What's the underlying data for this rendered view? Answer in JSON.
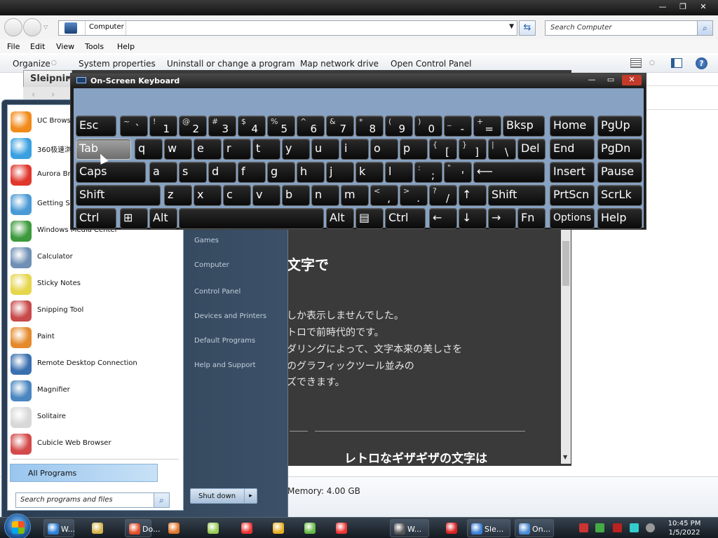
{
  "explorer": {
    "address": "Computer",
    "search_placeholder": "Search Computer",
    "menu": [
      "File",
      "Edit",
      "View",
      "Tools",
      "Help"
    ],
    "commands": [
      "Organize",
      "System properties",
      "Uninstall or change a program",
      "Map network drive",
      "Open Control Panel"
    ],
    "memory": "Memory: 4.00 GB"
  },
  "browser": {
    "title": "Sleipnir",
    "heading": "文字で",
    "lines": [
      "しか表示しませんでした。",
      "トロで前時代的です。",
      "ダリングによって、文字本来の美しさを",
      "のグラフィックツール並みの",
      "ズできます。"
    ],
    "heading2": "レトロなギザギザの文字は"
  },
  "osk": {
    "title": "On-Screen Keyboard"
  },
  "start_menu": {
    "programs": [
      {
        "label": "UC Browser",
        "color": "#f28a1a"
      },
      {
        "label": "360极速浏览器",
        "color": "#3aa0e0"
      },
      {
        "label": "Aurora Browser",
        "color": "#e0362c"
      },
      {
        "label": "Getting Started",
        "color": "#4a9ad6"
      },
      {
        "label": "Windows Media Center",
        "color": "#3c9a3c"
      },
      {
        "label": "Calculator",
        "color": "#6f8fb4"
      },
      {
        "label": "Sticky Notes",
        "color": "#e6d64c"
      },
      {
        "label": "Snipping Tool",
        "color": "#c84a4a"
      },
      {
        "label": "Paint",
        "color": "#e48a2b"
      },
      {
        "label": "Remote Desktop Connection",
        "color": "#3a6fb0"
      },
      {
        "label": "Magnifier",
        "color": "#4a86c0"
      },
      {
        "label": "Solitaire",
        "color": "#d8d8d8"
      },
      {
        "label": "Cubicle Web Browser",
        "color": "#d44a4a"
      }
    ],
    "all_programs": "All Programs",
    "search_placeholder": "Search programs and files",
    "right_items": [
      "Games",
      "Computer",
      "Control Panel",
      "Devices and Printers",
      "Default Programs",
      "Help and Support"
    ],
    "shutdown": "Shut down"
  },
  "taskbar": {
    "buttons": [
      "W...",
      "",
      "Do...",
      "",
      "",
      "",
      "",
      "",
      "",
      "W...",
      "",
      "Sle...",
      "On..."
    ],
    "time": "10:45 PM",
    "date": "1/5/2022"
  }
}
